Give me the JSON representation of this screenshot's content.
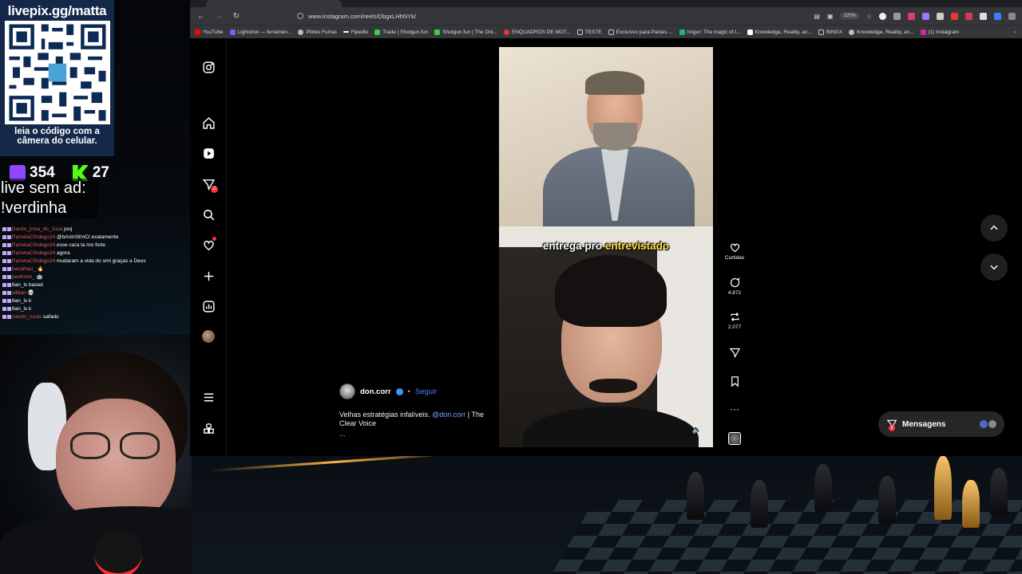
{
  "overlay": {
    "livepix_title": "livepix.gg/matta",
    "livepix_caption": "leia o código com a câmera do celular.",
    "viewers_twitch": "354",
    "viewers_kick": "27",
    "ad_line1": "live sem ad:",
    "ad_line2": "!verdinha",
    "chat": [
      {
        "user": "Danilo_jrrea_do_Jusa",
        "msg": "jooj"
      },
      {
        "user": "PamelaC0rdego24",
        "msg": "@bAnInSt!nCt exatamente"
      },
      {
        "user": "PamelaC0rdego24",
        "msg": "esse cara ta mo forte"
      },
      {
        "user": "PamelaC0rdego24",
        "msg": "agora"
      },
      {
        "user": "PamelaC0rdego24",
        "msg": "mudaram a vida do omi graças a Deus"
      },
      {
        "user": "bacalhau_",
        "msg": "🔥"
      },
      {
        "user": "pedrinho_",
        "msg": "🤖"
      },
      {
        "user": "6an_ls",
        "msg": "based"
      },
      {
        "user": "willian",
        "msg": "💀"
      },
      {
        "user": "6an_ls",
        "msg": "k"
      },
      {
        "user": "6an_ls",
        "msg": "k"
      },
      {
        "user": "naruto_lucas",
        "msg": "safado"
      }
    ]
  },
  "browser": {
    "url": "www.instagram.com/reels/DbgxLHhNYk/",
    "zoom": "120%",
    "bookmarks": [
      {
        "label": "YouTube",
        "color": "#ff0000"
      },
      {
        "label": "Lightshot — ferramen...",
        "color": "#7c5cff"
      },
      {
        "label": "Plinko Furras",
        "color": "#bbbbbb"
      },
      {
        "label": "Fipedle",
        "color": "#ffffff"
      },
      {
        "label": "Trade | Shotgun.fun",
        "color": "#3ad13a"
      },
      {
        "label": "Shotgun.fun | The Onl...",
        "color": "#3ad13a"
      },
      {
        "label": "ENQUADROS DE MOT...",
        "color": "#e53935"
      },
      {
        "label": "TESTE",
        "color": "#cccccc"
      },
      {
        "label": "Exclusivo para Países ...",
        "color": "#cccccc"
      },
      {
        "label": "Imgur: The magic of t...",
        "color": "#1bb76e"
      },
      {
        "label": "Knowledge, Reality, an...",
        "color": "#ffffff"
      },
      {
        "label": "BINGX",
        "color": "#cccccc"
      },
      {
        "label": "Knowledge, Reality, an...",
        "color": "#bbbbbb"
      },
      {
        "label": "(1) Instagram",
        "color": "#d6249f"
      }
    ]
  },
  "reel": {
    "caption_word1": "entrega pro",
    "caption_word2": "entrevistado",
    "username": "don.corr",
    "follow_label": "Seguir",
    "description_prefix": "Velhas estratégias infalíveis.",
    "mention": "@don.corr",
    "description_suffix": "| The Clear Voice",
    "more": "...",
    "likes_label": "Curtidas",
    "comments_count": "4.872",
    "reposts_count": "2.077",
    "nav_notifications_badge": "2"
  },
  "messages": {
    "label": "Mensagens",
    "badge": "2"
  },
  "colors": {
    "accent_link": "#4f7dff",
    "notif_red": "#ff3040",
    "livepix_bg": "#14294a",
    "caption_highlight": "#ffe14d"
  }
}
